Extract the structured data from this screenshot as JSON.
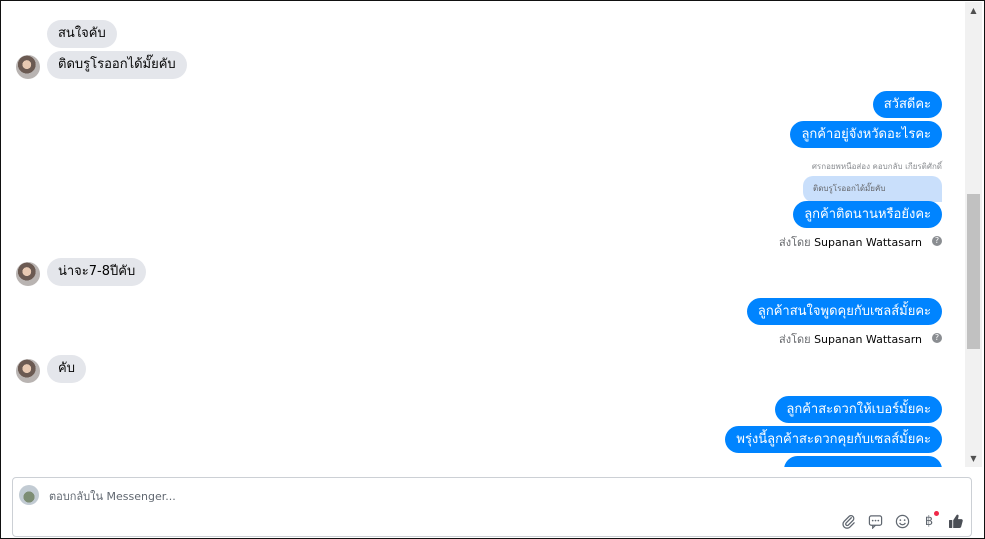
{
  "messages_in": [
    {
      "text": "สนใจคับ"
    },
    {
      "text": "ติดบรูโรออกได้มั๊ยคับ"
    },
    {
      "text": "น่าจะ7-8ปีคับ"
    },
    {
      "text": "คับ"
    }
  ],
  "messages_out": [
    {
      "text": "สวัสดีคะ"
    },
    {
      "text": "ลูกค้าอยู่จังหวัดอะไรคะ"
    },
    {
      "text": "ลูกค้าติดนานหรือยังคะ"
    },
    {
      "text": "ลูกค้าสนใจพูดคุยกับเซลส์มั้ยคะ"
    },
    {
      "text": "ลูกค้าสะดวกให้เบอร์มั้ยคะ"
    },
    {
      "text": "พรุ่งนี้ลูกค้าสะดวกคุยกับเซลส์มั้ยคะ"
    }
  ],
  "reply": {
    "note": "ศรกอยพหนือส่อง คอบกลับ เกียรติศักดิ์",
    "quoted_text": "ติดบรูโรออกได้มั๊ยคับ"
  },
  "sent_by": {
    "prefix": "ส่งโดย",
    "name": "Supanan Wattasarn"
  },
  "composer": {
    "placeholder": "ตอบกลับใน Messenger..."
  },
  "icons": {
    "attach": "paperclip-icon",
    "saved_replies": "chat-bubble-icon",
    "emoji": "smiley-icon",
    "payment": "baht-icon",
    "like": "thumbs-up-icon",
    "help": "question-circle-icon"
  },
  "colors": {
    "outgoing_bubble": "#0084ff",
    "incoming_bubble": "#e4e6eb",
    "quoted_bubble": "#c9dffb"
  }
}
